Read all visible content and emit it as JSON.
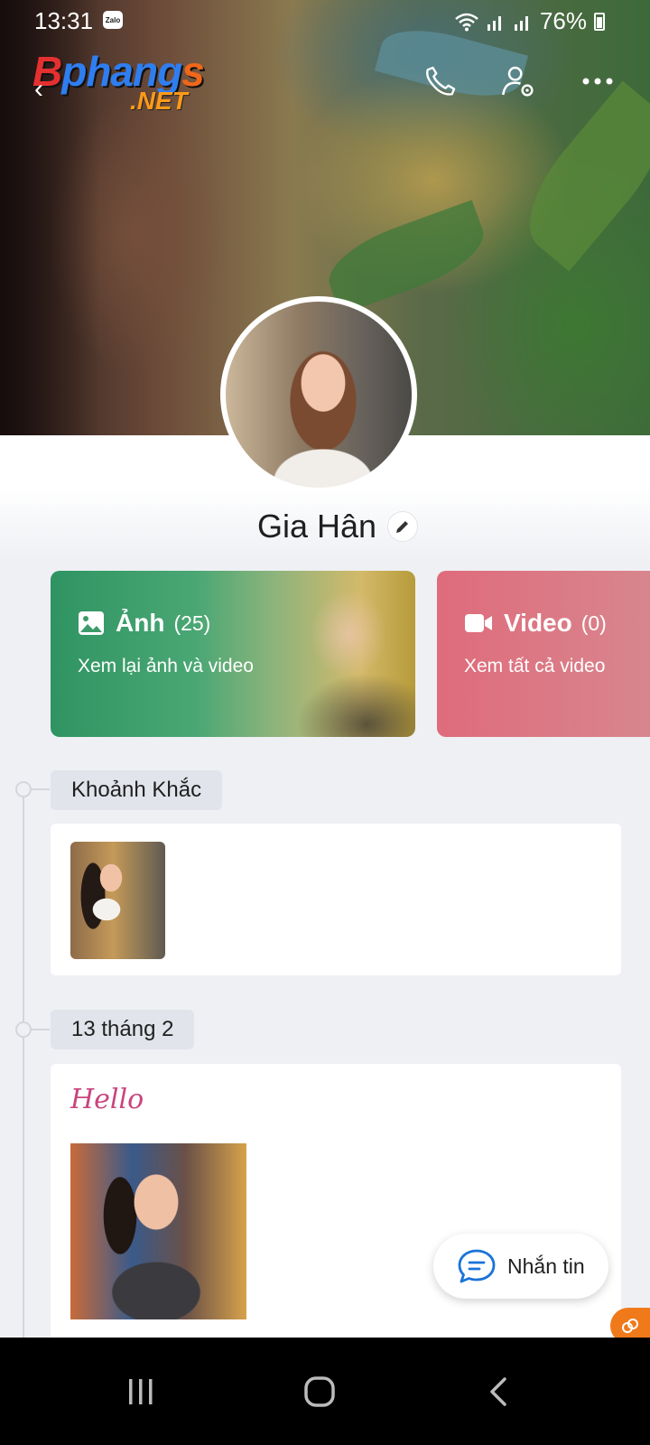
{
  "status_bar": {
    "time": "13:31",
    "notification_app": "Zalo",
    "battery": "76%"
  },
  "watermark": {
    "brand_main_b": "B",
    "brand_main": "phang",
    "brand_main_s": "s",
    "brand_suffix": ".NET"
  },
  "header": {
    "icons": [
      "back-icon",
      "phone-icon",
      "user-settings-icon",
      "more-icon"
    ]
  },
  "profile": {
    "name": "Gia Hân"
  },
  "media_cards": [
    {
      "icon": "image-icon",
      "label": "Ảnh",
      "count": "(25)",
      "subtitle": "Xem lại ảnh và video",
      "color": "#3d9b6a"
    },
    {
      "icon": "video-icon",
      "label": "Video",
      "count": "(0)",
      "subtitle": "Xem tất cả video",
      "color": "#de6e7e"
    }
  ],
  "timeline": [
    {
      "label": "Khoảnh Khắc"
    },
    {
      "label": "13 tháng 2",
      "post_text": "Hello"
    }
  ],
  "chat_button": {
    "label": "Nhắn tin",
    "icon": "chat-icon"
  },
  "nav_bar": {
    "icons": [
      "recent-apps-icon",
      "home-icon",
      "back-nav-icon"
    ]
  },
  "colors": {
    "background": "#eef0f4",
    "hello_text": "#c8457e",
    "chat_accent": "#1a73d9"
  }
}
